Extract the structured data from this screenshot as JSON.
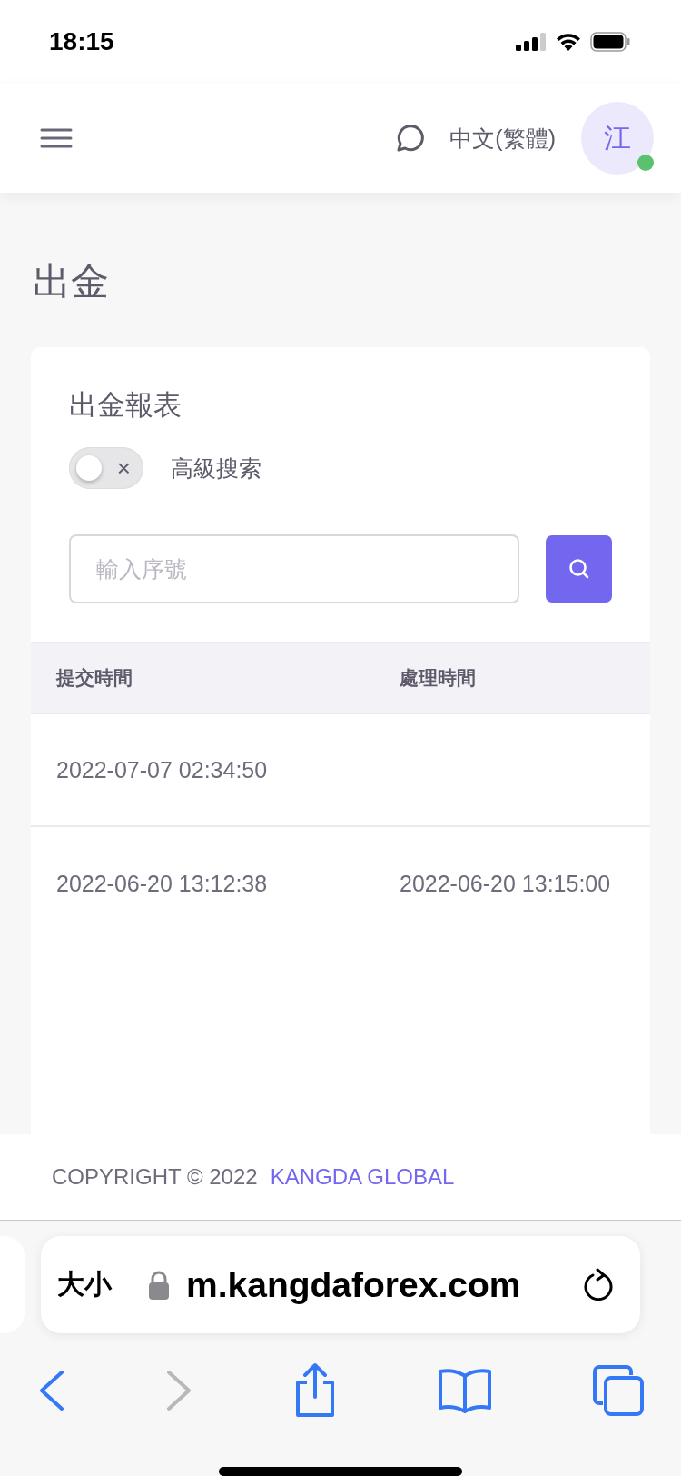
{
  "status_bar": {
    "time": "18:15"
  },
  "header": {
    "language": "中文(繁體)",
    "avatar": "江",
    "online": true
  },
  "page_title": "出金",
  "card": {
    "title": "出金報表",
    "advanced_search": {
      "label": "高級搜索",
      "on": false,
      "off_glyph": "×"
    },
    "search": {
      "placeholder": "輸入序號"
    },
    "table": {
      "columns": [
        "提交時間",
        "處理時間"
      ],
      "rows": [
        {
          "submitted": "2022-07-07 02:34:50"
        },
        {
          "submitted": "2022-06-20 13:12:38",
          "processed": "2022-06-20 13:15:00"
        }
      ]
    }
  },
  "footer": {
    "copyright": "COPYRIGHT © 2022",
    "company": "KANGDA GLOBAL"
  },
  "browser": {
    "text_size": "大小",
    "url": "m.kangdaforex.com",
    "back": {
      "disabled": false
    },
    "forward": {
      "disabled": true
    }
  }
}
